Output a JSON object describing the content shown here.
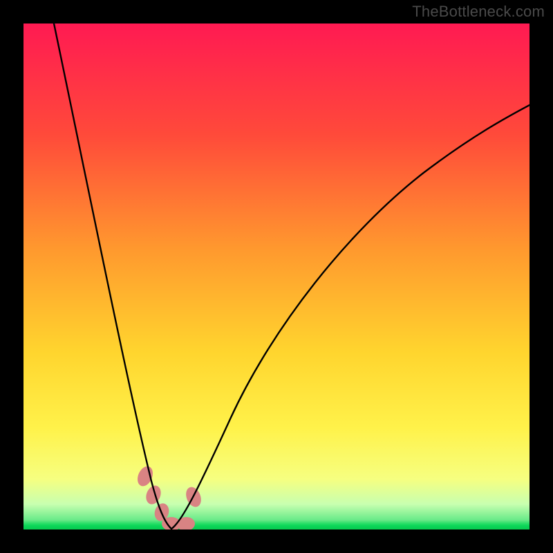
{
  "watermark": "TheBottleneck.com",
  "chart_data": {
    "type": "line",
    "title": "",
    "xlabel": "",
    "ylabel": "",
    "xlim": [
      0,
      100
    ],
    "ylim": [
      0,
      100
    ],
    "legend": false,
    "grid": false,
    "background_gradient": {
      "stops": [
        {
          "pos": 0.0,
          "color": "#ff1a52"
        },
        {
          "pos": 0.22,
          "color": "#ff4a3a"
        },
        {
          "pos": 0.45,
          "color": "#ff9a2e"
        },
        {
          "pos": 0.65,
          "color": "#ffd52e"
        },
        {
          "pos": 0.8,
          "color": "#fff24a"
        },
        {
          "pos": 0.9,
          "color": "#f6ff80"
        },
        {
          "pos": 0.95,
          "color": "#c8ffb0"
        },
        {
          "pos": 0.985,
          "color": "#5de884"
        },
        {
          "pos": 1.0,
          "color": "#08c94f"
        }
      ]
    },
    "series": [
      {
        "name": "left-arc",
        "x": [
          6,
          8,
          10,
          12,
          14,
          16,
          18,
          20,
          22,
          24,
          25.4,
          26.5,
          27.5,
          28.4,
          29.2
        ],
        "y": [
          100,
          90,
          80,
          70,
          61,
          52,
          43,
          34,
          25,
          16,
          10,
          6,
          3,
          1,
          0
        ]
      },
      {
        "name": "right-arc",
        "x": [
          29.2,
          30.5,
          33,
          36,
          40,
          45,
          50,
          56,
          63,
          70,
          78,
          86,
          94,
          100
        ],
        "y": [
          0,
          3,
          10,
          18,
          28,
          38,
          46,
          54,
          61,
          67,
          72,
          77,
          81,
          84
        ]
      }
    ],
    "annotations": {
      "highlight_region_color": "#d98383",
      "highlight_points": [
        {
          "x": 23.8,
          "y": 11.0
        },
        {
          "x": 25.6,
          "y": 6.5
        },
        {
          "x": 27.2,
          "y": 3.0
        },
        {
          "x": 28.8,
          "y": 0.9
        },
        {
          "x": 31.4,
          "y": 0.8
        },
        {
          "x": 33.6,
          "y": 6.7
        }
      ]
    }
  }
}
